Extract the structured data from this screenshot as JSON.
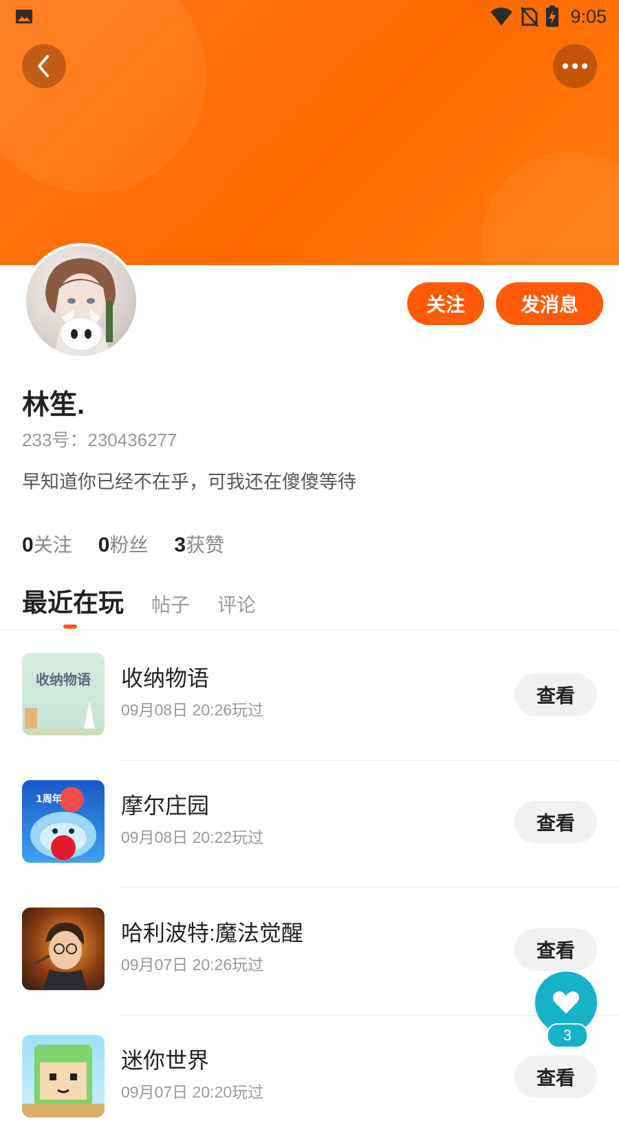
{
  "status_bar": {
    "time": "9:05"
  },
  "profile": {
    "name": "林笙.",
    "uid": "233号：230436277",
    "bio": "早知道你已经不在乎，可我还在傻傻等待"
  },
  "actions": {
    "follow_label": "关注",
    "message_label": "发消息"
  },
  "stats": [
    {
      "count": "0",
      "label": "关注"
    },
    {
      "count": "0",
      "label": "粉丝"
    },
    {
      "count": "3",
      "label": "获赞"
    }
  ],
  "tabs": {
    "active": "最近在玩",
    "posts": "帖子",
    "comments": "评论"
  },
  "games": [
    {
      "name": "收纳物语",
      "time": "09月08日 20:26玩过",
      "button": "查看",
      "icon_text": "收纳物语"
    },
    {
      "name": "摩尔庄园",
      "time": "09月08日 20:22玩过",
      "button": "查看",
      "icon_text": "1周年"
    },
    {
      "name": "哈利波特:魔法觉醒",
      "time": "09月07日 20:26玩过",
      "button": "查看"
    },
    {
      "name": "迷你世界",
      "time": "09月07日 20:20玩过",
      "button": "查看"
    }
  ],
  "like_fab": {
    "count": "3"
  },
  "colors": {
    "accent": "#ff5a0a",
    "header": "#ff6a00",
    "fab": "#17b1c8"
  }
}
